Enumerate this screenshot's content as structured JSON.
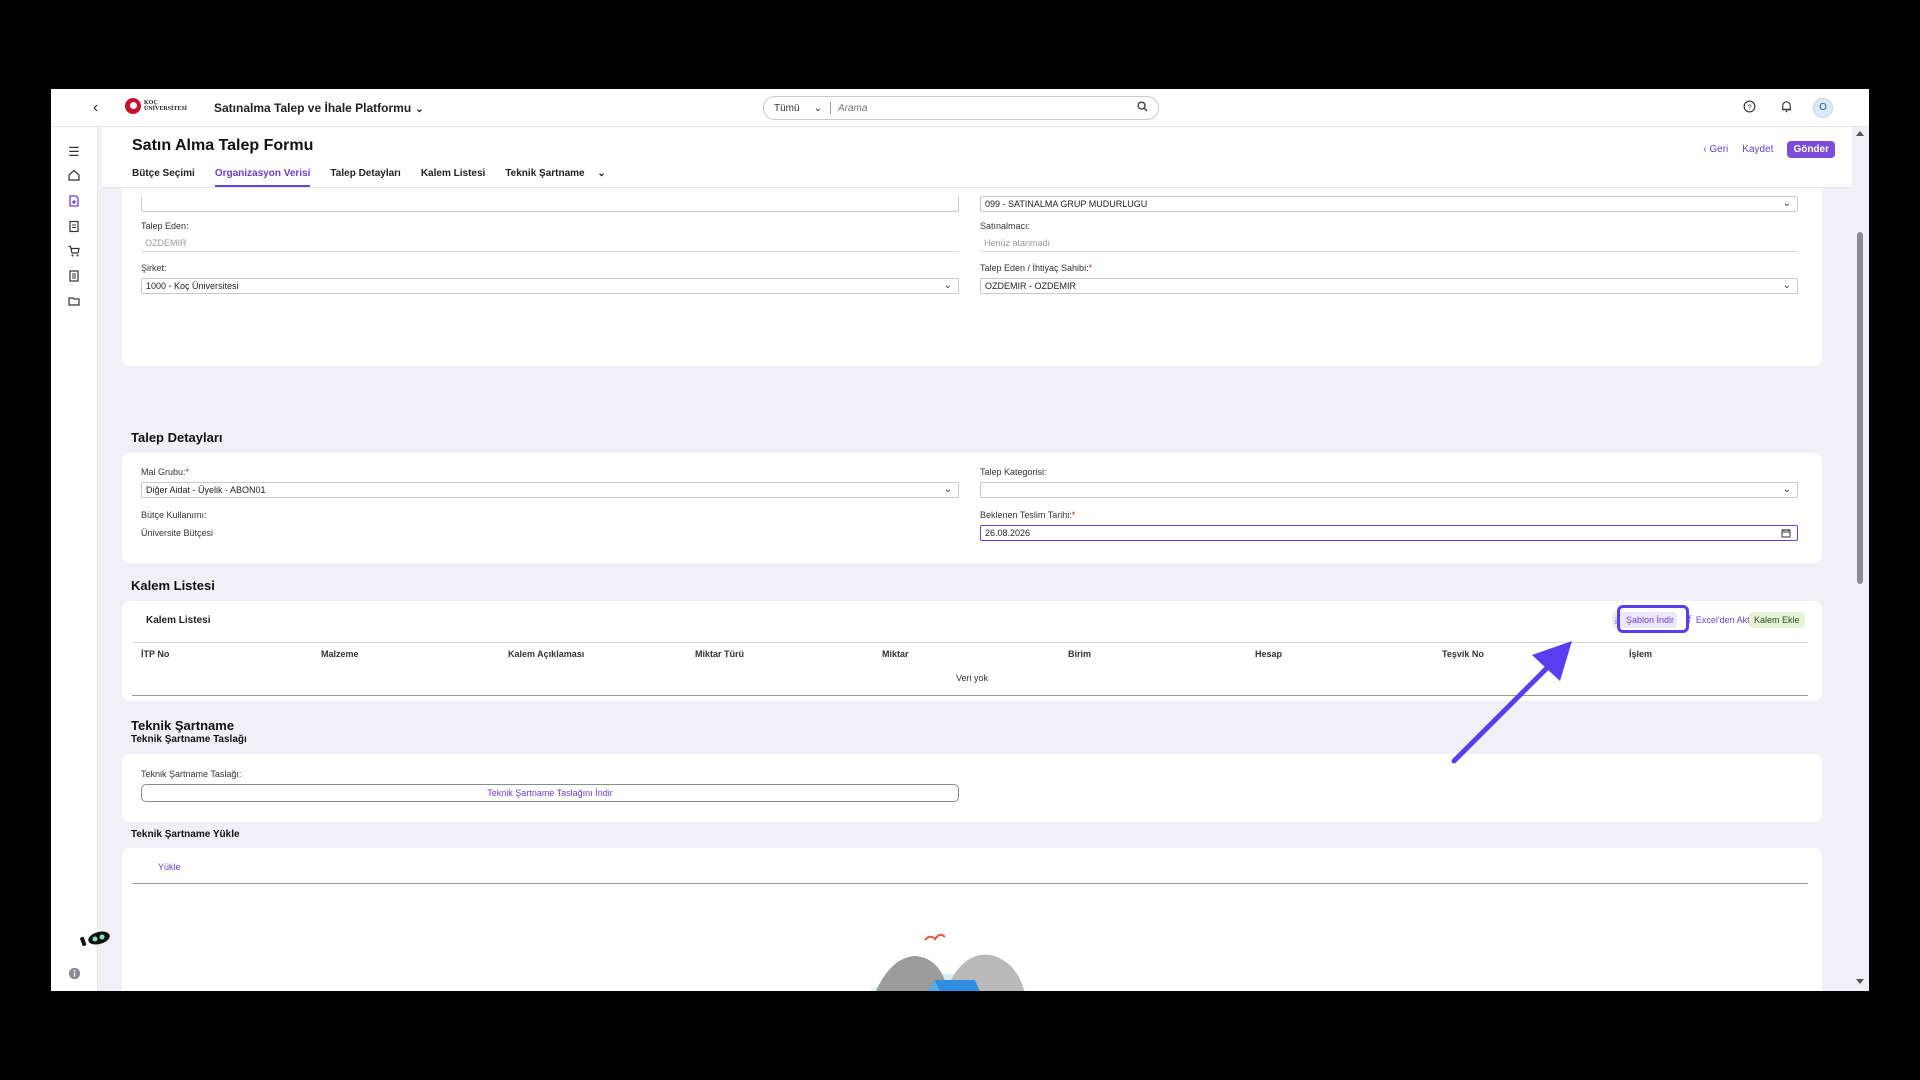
{
  "shell": {
    "back": "‹",
    "logo_text": "KOÇ ÜNİVERSİTESİ",
    "app_title": "Satınalma Talep ve İhale Platformu",
    "search_scope": "Tümü",
    "search_placeholder": "Arama",
    "avatar_initial": "O"
  },
  "page": {
    "title": "Satın Alma Talep Formu",
    "actions": {
      "back": "Geri",
      "save": "Kaydet",
      "send": "Gönder"
    },
    "tabs": [
      {
        "label": "Bütçe Seçimi"
      },
      {
        "label": "Organizasyon Verisi"
      },
      {
        "label": "Talep Detayları"
      },
      {
        "label": "Kalem Listesi"
      },
      {
        "label": "Teknik Şartname"
      }
    ],
    "active_tab": "Organizasyon Verisi"
  },
  "org": {
    "top_right_value": "099 - SATINALMA GRUP MUDURLUGU",
    "talep_eden_label": "Talep Eden:",
    "talep_eden_value": "OZDEMIR",
    "satinalmaci_label": "Satınalmacı:",
    "satinalmaci_placeholder": "Henüz atanmadı",
    "sirket_label": "Şirket:",
    "sirket_value": "1000 - Koç Üniversitesi",
    "ihtiyac_label": "Talep Eden / İhtiyaç Sahibi:",
    "ihtiyac_value": "OZDEMIR - OZDEMIR"
  },
  "details": {
    "section_title": "Talep Detayları",
    "mal_grubu_label": "Mal Grubu:",
    "mal_grubu_value": "Diğer Aidat - Üyelik - ABON01",
    "kategori_label": "Talep Kategorisi:",
    "kategori_value": "",
    "butce_label": "Bütçe Kullanımı:",
    "butce_value": "Üniversite Bütçesi",
    "teslim_label": "Beklenen Teslim Tarihi:",
    "teslim_value": "26.08.2026"
  },
  "items": {
    "section_title": "Kalem Listesi",
    "table_title": "Kalem Listesi",
    "buttons": {
      "template": "Şablon İndir",
      "excel": "Excel'den Aktar",
      "add": "Kalem Ekle"
    },
    "columns": [
      "İTP No",
      "Malzeme",
      "Kalem Açıklaması",
      "Miktar Türü",
      "Miktar",
      "Birim",
      "Hesap",
      "Teşvik No",
      "İşlem"
    ],
    "empty": "Veri yok"
  },
  "spec": {
    "section_title": "Teknik Şartname",
    "draft_title": "Teknik Şartname Taslağı",
    "draft_label": "Teknik Şartname Taslağı:",
    "draft_button": "Teknik Şartname Taslağını İndir",
    "upload_title": "Teknik Şartname Yükle",
    "upload_tab": "Yükle"
  },
  "colors": {
    "accent": "#6a3fd6",
    "primary_button": "#7c4ddb",
    "highlight": "#5b3df0",
    "add_button_bg": "#e6f3d6"
  }
}
